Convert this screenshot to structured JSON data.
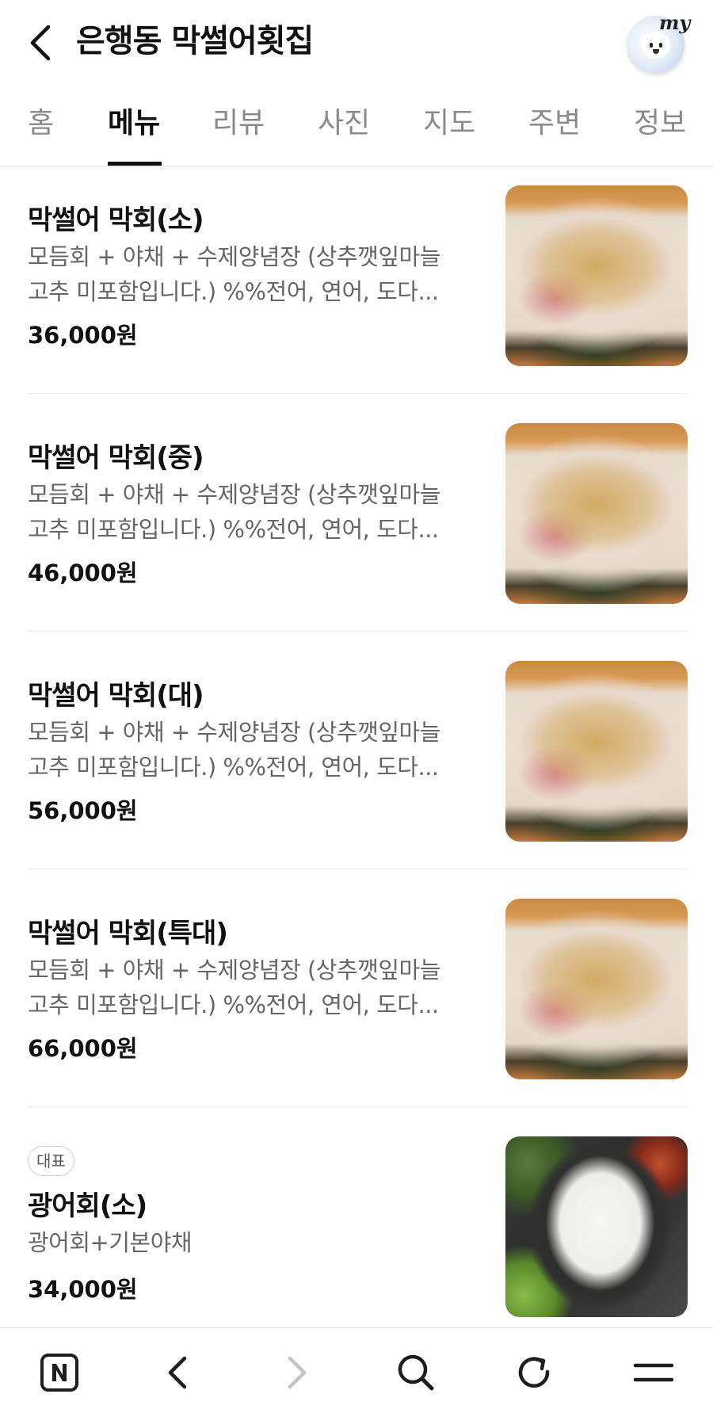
{
  "header": {
    "title": "은행동 막썰어횟집",
    "avatar_text": "my"
  },
  "tabs": [
    {
      "label": "홈",
      "active": false
    },
    {
      "label": "메뉴",
      "active": true
    },
    {
      "label": "리뷰",
      "active": false
    },
    {
      "label": "사진",
      "active": false
    },
    {
      "label": "지도",
      "active": false
    },
    {
      "label": "주변",
      "active": false
    },
    {
      "label": "정보",
      "active": false
    }
  ],
  "menu": {
    "items": [
      {
        "name": "막썰어 막회(소)",
        "desc_line1": "모듬회 + 야채 + 수제양념장 (상추깻잎마늘",
        "desc_line2": "고추 미포함입니다.) %%전어, 연어, 도다...",
        "price": "36,000원",
        "image": "mixed-sashimi-platter"
      },
      {
        "name": "막썰어 막회(중)",
        "desc_line1": "모듬회 + 야채 + 수제양념장 (상추깻잎마늘",
        "desc_line2": "고추 미포함입니다.) %%전어, 연어, 도다...",
        "price": "46,000원",
        "image": "mixed-sashimi-platter"
      },
      {
        "name": "막썰어 막회(대)",
        "desc_line1": "모듬회 + 야채 + 수제양념장 (상추깻잎마늘",
        "desc_line2": "고추 미포함입니다.) %%전어, 연어, 도다...",
        "price": "56,000원",
        "image": "mixed-sashimi-platter"
      },
      {
        "name": "막썰어 막회(특대)",
        "desc_line1": "모듬회 + 야채 + 수제양념장 (상추깻잎마늘",
        "desc_line2": "고추 미포함입니다.) %%전어, 연어, 도다...",
        "price": "66,000원",
        "image": "mixed-sashimi-platter"
      },
      {
        "badge": "대표",
        "name": "광어회(소)",
        "desc_line1": "광어회+기본야채",
        "price": "34,000원",
        "image": "flatfish-sashimi-platter"
      }
    ]
  },
  "bottom_nav": {
    "icons": [
      "naver-home-icon",
      "back-arrow-icon",
      "forward-arrow-icon",
      "search-icon",
      "refresh-icon",
      "menu-icon"
    ]
  },
  "colors": {
    "text_primary": "#111111",
    "text_secondary": "#666666",
    "tab_inactive": "#8a8a8a",
    "divider": "#ececec"
  }
}
